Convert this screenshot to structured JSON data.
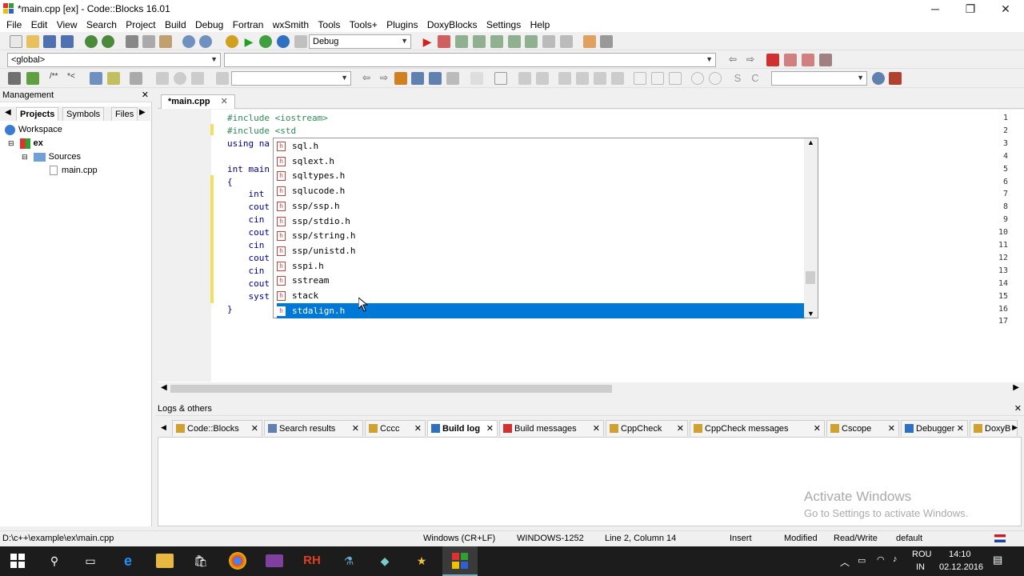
{
  "window": {
    "title": "*main.cpp [ex] - Code::Blocks 16.01",
    "minimize": "─",
    "maximize": "❐",
    "close": "✕"
  },
  "menu": [
    "File",
    "Edit",
    "View",
    "Search",
    "Project",
    "Build",
    "Debug",
    "Fortran",
    "wxSmith",
    "Tools",
    "Tools+",
    "Plugins",
    "DoxyBlocks",
    "Settings",
    "Help"
  ],
  "toolbar": {
    "build_target": "Debug",
    "scope": "<global>",
    "function": "",
    "search": ""
  },
  "management": {
    "title": "Management",
    "close": "✕",
    "tabs": [
      "Projects",
      "Symbols",
      "Files"
    ],
    "tree": {
      "workspace": "Workspace",
      "project": "ex",
      "folder": "Sources",
      "file": "main.cpp"
    }
  },
  "editor": {
    "tab_label": "*main.cpp",
    "tab_close": "✕",
    "lines": [
      {
        "n": "1",
        "pre": "#include <iostream>",
        "code": ""
      },
      {
        "n": "2",
        "pre": "#include <std",
        "code": ""
      },
      {
        "n": "3",
        "pre": "",
        "code": "using na"
      },
      {
        "n": "4",
        "pre": "",
        "code": ""
      },
      {
        "n": "5",
        "pre": "",
        "code": "int main"
      },
      {
        "n": "6",
        "pre": "",
        "code": "{"
      },
      {
        "n": "7",
        "pre": "",
        "code": "    int"
      },
      {
        "n": "8",
        "pre": "",
        "code": "    cout"
      },
      {
        "n": "9",
        "pre": "",
        "code": "    cin"
      },
      {
        "n": "10",
        "pre": "",
        "code": "    cout"
      },
      {
        "n": "11",
        "pre": "",
        "code": "    cin"
      },
      {
        "n": "12",
        "pre": "",
        "code": "    cout"
      },
      {
        "n": "13",
        "pre": "",
        "code": "    cin"
      },
      {
        "n": "14",
        "pre": "",
        "code": "    cout"
      },
      {
        "n": "15",
        "pre": "",
        "code": "    syst"
      },
      {
        "n": "16",
        "pre": "",
        "code": "}"
      },
      {
        "n": "17",
        "pre": "",
        "code": ""
      }
    ]
  },
  "autocomplete": {
    "items": [
      "sql.h",
      "sqlext.h",
      "sqltypes.h",
      "sqlucode.h",
      "ssp/ssp.h",
      "ssp/stdio.h",
      "ssp/string.h",
      "ssp/unistd.h",
      "sspi.h",
      "sstream",
      "stack",
      "stdalign.h"
    ],
    "selected": "stdalign.h",
    "icon_letter": "h"
  },
  "logs": {
    "title": "Logs & others",
    "close": "✕",
    "tabs": [
      "Code::Blocks",
      "Search results",
      "Cccc",
      "Build log",
      "Build messages",
      "CppCheck",
      "CppCheck messages",
      "Cscope",
      "Debugger",
      "DoxyB"
    ],
    "active_tab": "Build log"
  },
  "watermark": {
    "line1": "Activate Windows",
    "line2": "Go to Settings to activate Windows."
  },
  "status": {
    "path": "D:\\c++\\example\\ex\\main.cpp",
    "eol": "Windows (CR+LF)",
    "encoding": "WINDOWS-1252",
    "position": "Line 2, Column 14",
    "mode": "Insert",
    "modified": "Modified",
    "access": "Read/Write",
    "profile": "default"
  },
  "taskbar": {
    "lang1": "ROU",
    "lang2": "IN",
    "time": "14:10",
    "date": "02.12.2016",
    "rh_label": "RH"
  },
  "colors": {
    "selection": "#0078d7",
    "taskbar": "#1c1c1c",
    "preprocessor": "#2e8b57"
  }
}
